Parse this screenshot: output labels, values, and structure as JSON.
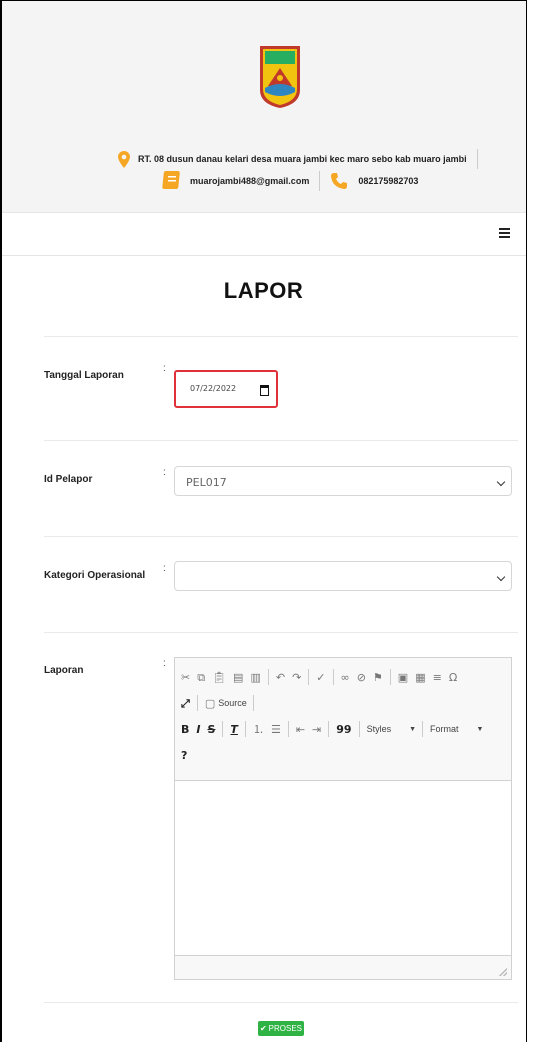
{
  "header": {
    "address": "RT. 08 dusun danau kelari desa muara jambi kec maro sebo kab muaro jambi",
    "email": "muarojambi488@gmail.com",
    "phone": "082175982703",
    "icons": {
      "address": "map-pin-icon",
      "email": "notebook-icon",
      "phone": "phone-icon",
      "menu": "hamburger-menu-icon"
    },
    "accent_color": "#f5a623"
  },
  "page": {
    "title": "LAPOR"
  },
  "form": {
    "tanggal_label": "Tanggal Laporan",
    "tanggal_value": "07/22/2022",
    "pelapor_label": "Id Pelapor",
    "pelapor_value": "PEL017",
    "kategori_label": "Kategori Operasional",
    "kategori_value": "",
    "laporan_label": "Laporan",
    "colon": ":",
    "date_border_color": "#e0303a"
  },
  "editor": {
    "source_label": "Source",
    "styles_label": "Styles",
    "format_label": "Format",
    "help_label": "?",
    "bold": "B",
    "italic": "I",
    "strike": "S",
    "quote": "99"
  },
  "submit": {
    "label": "PROSES",
    "color": "#2fb344"
  }
}
